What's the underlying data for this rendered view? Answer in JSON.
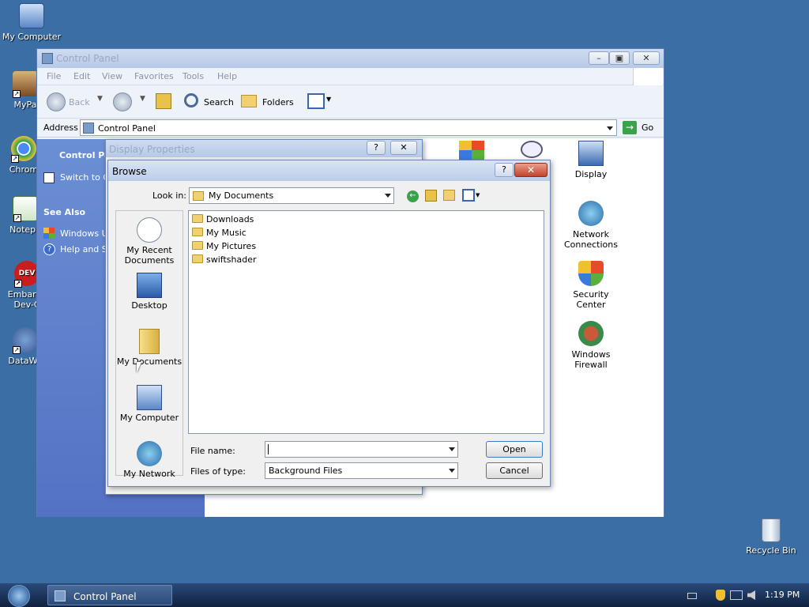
{
  "desktop": {
    "icons": [
      {
        "label": "My Computer"
      },
      {
        "label": "MyPa"
      },
      {
        "label": "Chrom"
      },
      {
        "label": "Notepa"
      },
      {
        "label": "Embarca\nDev-C"
      },
      {
        "label": "DataWa"
      }
    ],
    "recycle_bin": "Recycle Bin"
  },
  "control_panel": {
    "title": "Control Panel",
    "menu": [
      "File",
      "Edit",
      "View",
      "Favorites",
      "Tools",
      "Help"
    ],
    "toolbar": {
      "back": "Back",
      "search": "Search",
      "folders": "Folders"
    },
    "address_label": "Address",
    "address_value": "Control Panel",
    "go": "Go",
    "left_panel": {
      "header": "Control Pa",
      "switch": "Switch to C",
      "see_also": "See Also",
      "windows_update": "Windows U",
      "help_support": "Help and S"
    },
    "icons": [
      {
        "label": "Display"
      },
      {
        "label": "Network Connections"
      },
      {
        "label": "Security Center"
      },
      {
        "label": "Windows Firewall"
      }
    ]
  },
  "display_properties": {
    "title": "Display Properties"
  },
  "browse": {
    "title": "Browse",
    "look_in_label": "Look in:",
    "look_in_value": "My Documents",
    "places": [
      {
        "label": "My Recent Documents"
      },
      {
        "label": "Desktop"
      },
      {
        "label": "My Documents"
      },
      {
        "label": "My Computer"
      },
      {
        "label": "My Network"
      }
    ],
    "files": [
      {
        "name": "Downloads"
      },
      {
        "name": "My Music"
      },
      {
        "name": "My Pictures"
      },
      {
        "name": "swiftshader"
      }
    ],
    "file_name_label": "File name:",
    "file_name_value": "",
    "file_type_label": "Files of type:",
    "file_type_value": "Background Files",
    "open": "Open",
    "cancel": "Cancel"
  },
  "taskbar": {
    "task": "Control Panel",
    "clock": "1:19 PM"
  }
}
